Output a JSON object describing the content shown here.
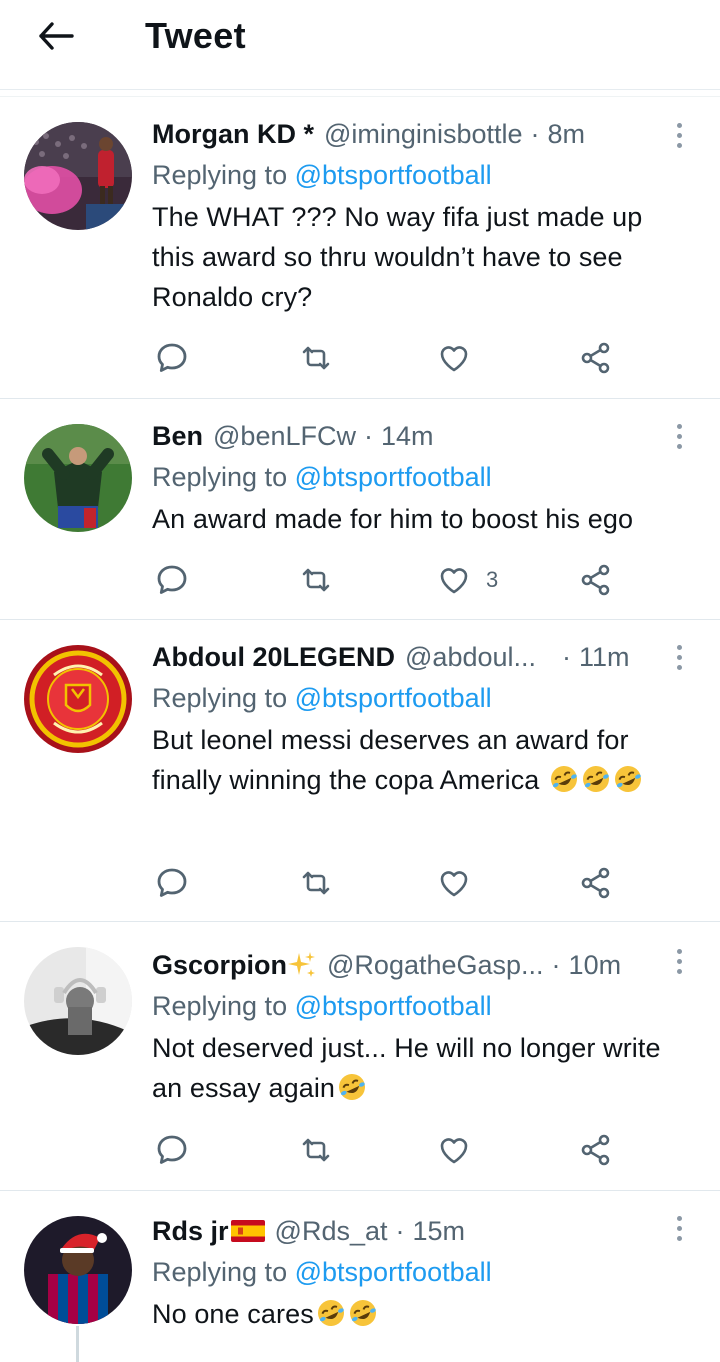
{
  "header": {
    "title": "Tweet"
  },
  "colors": {
    "accent": "#1d9bf0",
    "secondary_text": "#536471",
    "text": "#0f1419",
    "divider": "#e1e8ed"
  },
  "tweets": [
    {
      "name": "Morgan KD *",
      "handle": "@iminginisbottle",
      "separator": "·",
      "time": "8m",
      "replying_prefix": "Replying to",
      "replying_to": "@btsportfootball",
      "text": "The WHAT ??? No way fifa just made up this award so thru wouldn’t have to see Ronaldo cry?",
      "like_count": ""
    },
    {
      "name": "Ben",
      "handle": "@benLFCw",
      "separator": "·",
      "time": "14m",
      "replying_prefix": "Replying to",
      "replying_to": "@btsportfootball",
      "text": "An award made for him to boost his ego",
      "like_count": "3"
    },
    {
      "name": "Abdoul 20LEGEND",
      "handle": "@abdoul...",
      "separator": "·",
      "time": "11m",
      "replying_prefix": "Replying to",
      "replying_to": "@btsportfootball",
      "text": "But leonel messi deserves an award for finally winning the copa America",
      "like_count": ""
    },
    {
      "name": "Gscorpion",
      "handle": "@RogatheGasp...",
      "separator": "·",
      "time": "10m",
      "replying_prefix": "Replying to",
      "replying_to": "@btsportfootball",
      "text": "Not deserved just... He will no longer write an essay again",
      "like_count": ""
    },
    {
      "name": "Rds jr",
      "handle": "@Rds_at",
      "separator": "·",
      "time": "15m",
      "replying_prefix": "Replying to",
      "replying_to": "@btsportfootball",
      "text": "No one cares",
      "like_count": ""
    }
  ],
  "icons": {
    "back": "arrow-left-icon",
    "reply": "speech-bubble-icon",
    "retweet": "retweet-icon",
    "like": "heart-icon",
    "share": "share-nodes-icon",
    "more": "more-vertical-icon",
    "emoji": "rolling-on-floor-laughing-emoji",
    "sparkles": "sparkles-emoji",
    "flag": "spain-flag-emoji"
  }
}
